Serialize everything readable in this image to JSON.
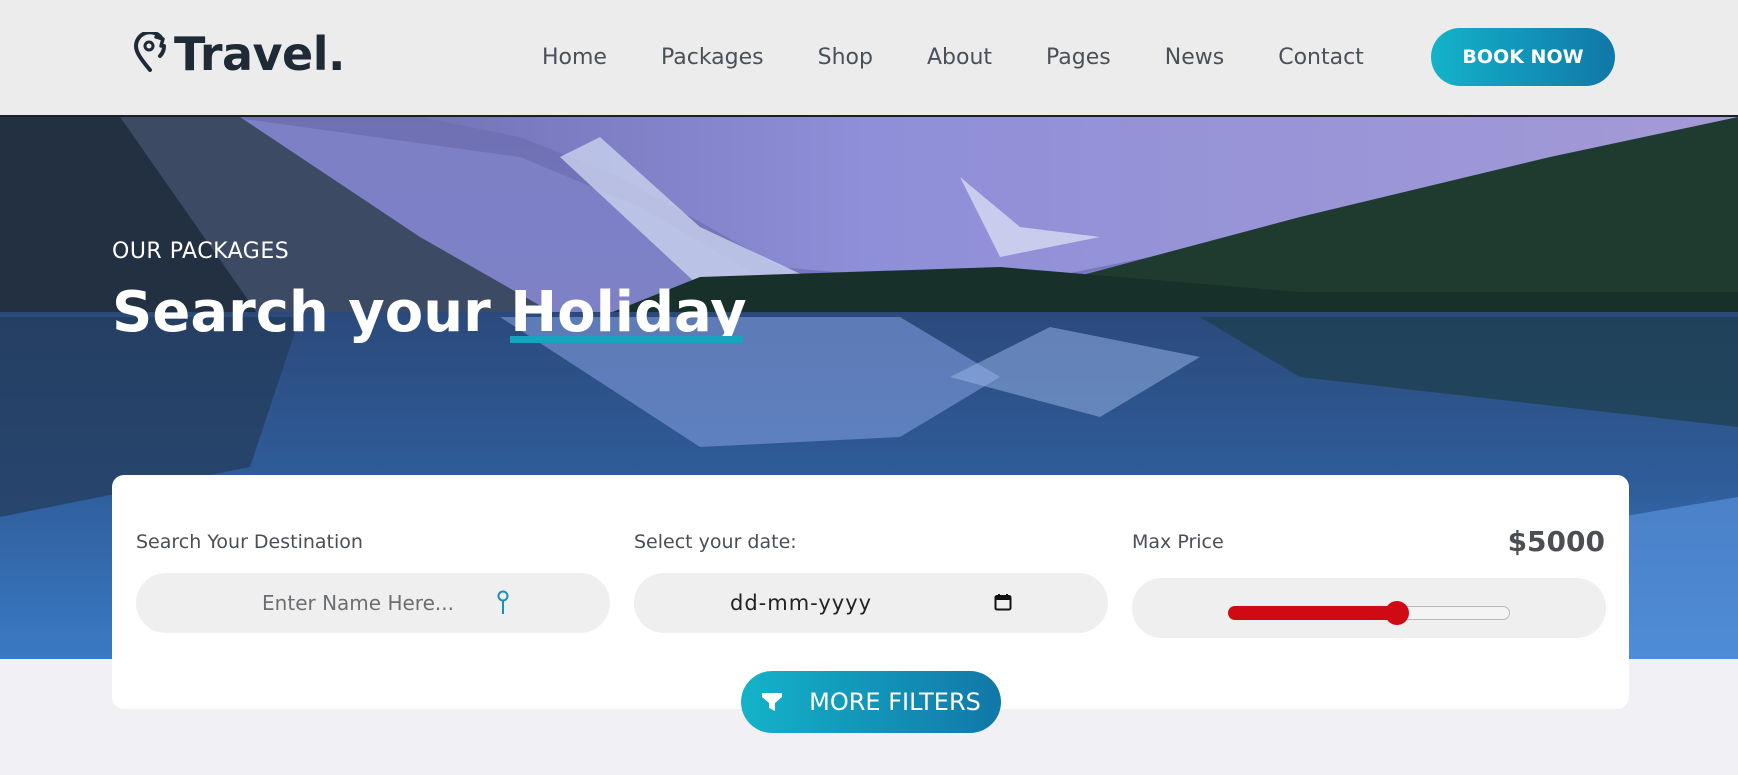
{
  "brand": {
    "name": "Travel.",
    "logo_icon": "map-pin-arrow-icon"
  },
  "nav": {
    "items": [
      {
        "label": "Home"
      },
      {
        "label": "Packages"
      },
      {
        "label": "Shop"
      },
      {
        "label": "About"
      },
      {
        "label": "Pages"
      },
      {
        "label": "News"
      },
      {
        "label": "Contact"
      }
    ],
    "cta_label": "BOOK NOW"
  },
  "hero": {
    "kicker": "OUR PACKAGES",
    "title_prefix": "Search your ",
    "title_highlight": "Holiday"
  },
  "search": {
    "destination": {
      "label": "Search Your Destination",
      "placeholder": "Enter Name Here...",
      "value": "",
      "icon": "map-pin-icon"
    },
    "date": {
      "label": "Select your date:",
      "placeholder": "dd-mm-yyyy",
      "icon": "calendar-icon"
    },
    "price": {
      "label": "Max Price",
      "value_text": "$5000",
      "slider_fraction": 0.6
    },
    "more_filters": {
      "label": "MORE FILTERS",
      "icon": "filter-icon"
    }
  },
  "colors": {
    "accent": "#13b3c9",
    "accent_dark": "#1177a8",
    "slider": "#d00a14",
    "brand_text": "#1e2a35"
  }
}
